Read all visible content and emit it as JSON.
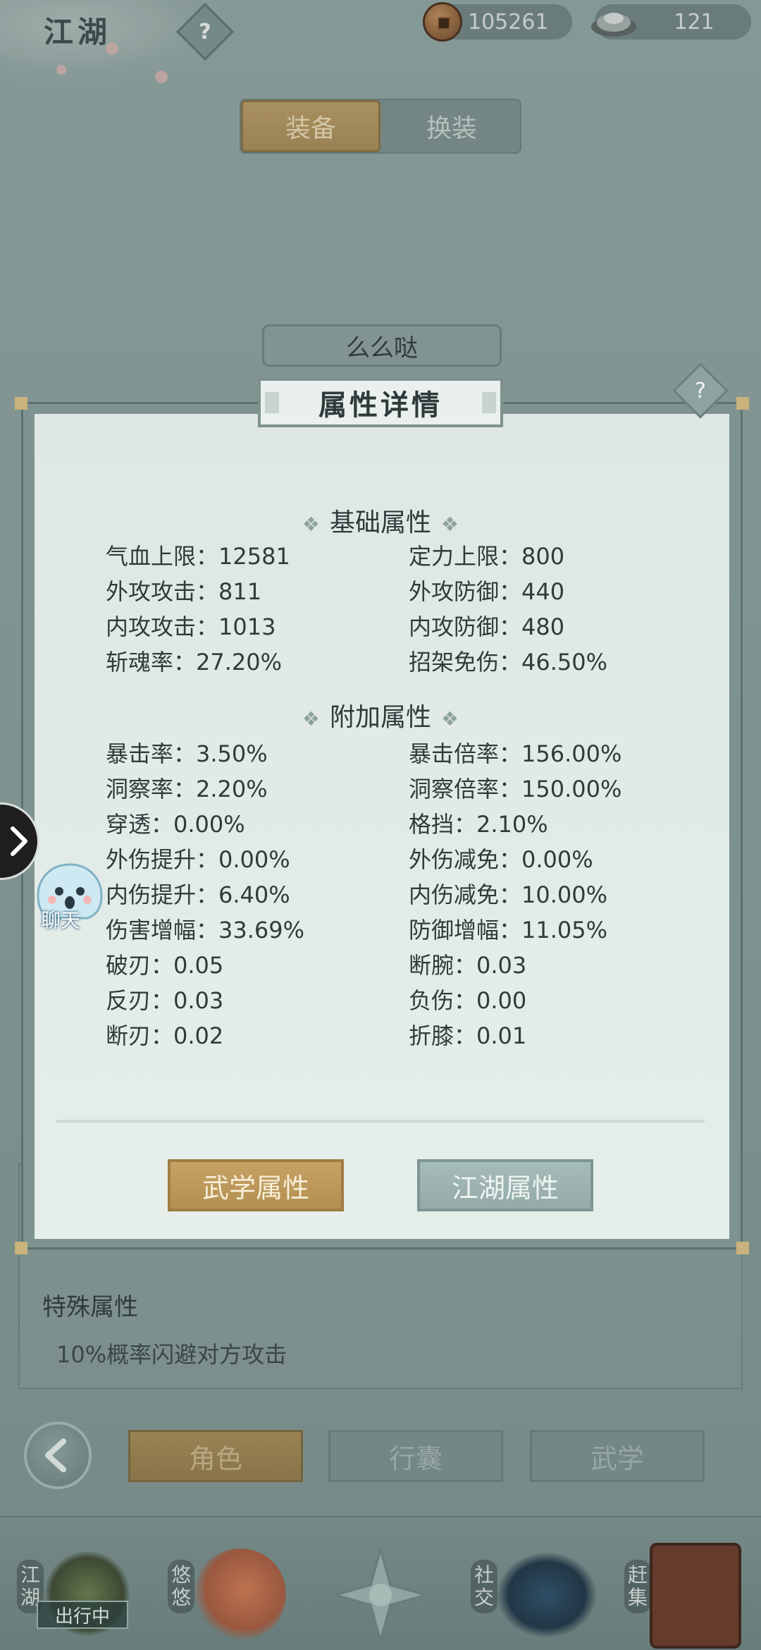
{
  "header": {
    "title": "江湖",
    "help_symbol": "?",
    "copper_amount": "105261",
    "silver_amount": "121"
  },
  "main_tabs": [
    {
      "label": "装备",
      "active": true
    },
    {
      "label": "换装",
      "active": false
    }
  ],
  "character": {
    "name": "么么哒"
  },
  "background_panel": {
    "special_title": "特殊属性",
    "special_desc": "10%概率闪避对方攻击"
  },
  "bottom_nav": {
    "tabs": [
      {
        "label": "角色",
        "active": true
      },
      {
        "label": "行囊",
        "active": false
      },
      {
        "label": "武学",
        "active": false
      }
    ]
  },
  "bottom_bar": {
    "items": [
      "江湖",
      "悠悠",
      "社交",
      "赶集"
    ],
    "status": "出行中"
  },
  "side": {
    "chat_label": "聊天"
  },
  "modal": {
    "title": "属性详情",
    "help_symbol": "?",
    "basic_section": "基础属性",
    "basic_stats": [
      {
        "label": "气血上限：",
        "value": "12581"
      },
      {
        "label": "定力上限：",
        "value": "800"
      },
      {
        "label": "外攻攻击：",
        "value": "811"
      },
      {
        "label": "外攻防御：",
        "value": "440"
      },
      {
        "label": "内攻攻击：",
        "value": "1013"
      },
      {
        "label": "内攻防御：",
        "value": "480"
      },
      {
        "label": "斩魂率：",
        "value": "27.20%"
      },
      {
        "label": "招架免伤：",
        "value": "46.50%"
      }
    ],
    "extra_section": "附加属性",
    "extra_stats": [
      {
        "label": "暴击率：",
        "value": "3.50%"
      },
      {
        "label": "暴击倍率：",
        "value": "156.00%"
      },
      {
        "label": "洞察率：",
        "value": "2.20%"
      },
      {
        "label": "洞察倍率：",
        "value": "150.00%"
      },
      {
        "label": "穿透：",
        "value": "0.00%"
      },
      {
        "label": "格挡：",
        "value": "2.10%"
      },
      {
        "label": "外伤提升：",
        "value": "0.00%"
      },
      {
        "label": "外伤减免：",
        "value": "0.00%"
      },
      {
        "label": "内伤提升：",
        "value": "6.40%"
      },
      {
        "label": "内伤减免：",
        "value": "10.00%"
      },
      {
        "label": "伤害增幅：",
        "value": "33.69%"
      },
      {
        "label": "防御增幅：",
        "value": "11.05%"
      },
      {
        "label": "破刃：",
        "value": "0.05"
      },
      {
        "label": "断腕：",
        "value": "0.03"
      },
      {
        "label": "反刃：",
        "value": "0.03"
      },
      {
        "label": "负伤：",
        "value": "0.00"
      },
      {
        "label": "断刃：",
        "value": "0.02"
      },
      {
        "label": "折膝：",
        "value": "0.01"
      }
    ],
    "buttons": {
      "martial": "武学属性",
      "jianghu": "江湖属性"
    }
  }
}
